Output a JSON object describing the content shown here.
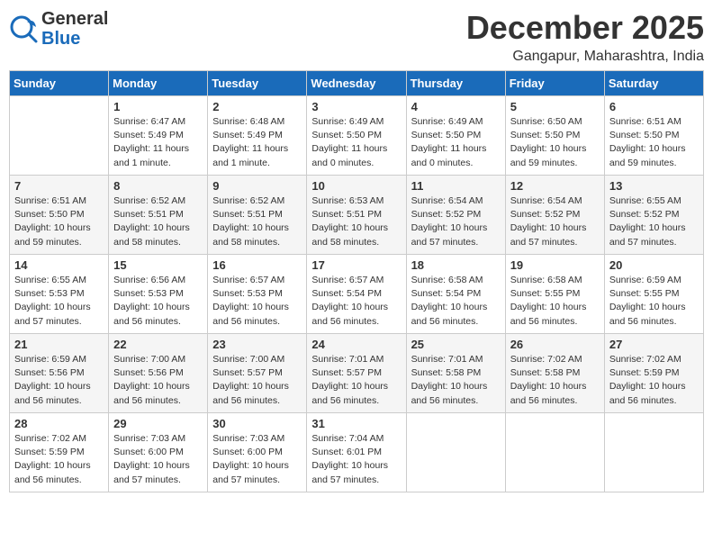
{
  "logo": {
    "general": "General",
    "blue": "Blue"
  },
  "title": {
    "month_year": "December 2025",
    "location": "Gangapur, Maharashtra, India"
  },
  "weekdays": [
    "Sunday",
    "Monday",
    "Tuesday",
    "Wednesday",
    "Thursday",
    "Friday",
    "Saturday"
  ],
  "weeks": [
    [
      {
        "day": "",
        "info": ""
      },
      {
        "day": "1",
        "info": "Sunrise: 6:47 AM\nSunset: 5:49 PM\nDaylight: 11 hours\nand 1 minute."
      },
      {
        "day": "2",
        "info": "Sunrise: 6:48 AM\nSunset: 5:49 PM\nDaylight: 11 hours\nand 1 minute."
      },
      {
        "day": "3",
        "info": "Sunrise: 6:49 AM\nSunset: 5:50 PM\nDaylight: 11 hours\nand 0 minutes."
      },
      {
        "day": "4",
        "info": "Sunrise: 6:49 AM\nSunset: 5:50 PM\nDaylight: 11 hours\nand 0 minutes."
      },
      {
        "day": "5",
        "info": "Sunrise: 6:50 AM\nSunset: 5:50 PM\nDaylight: 10 hours\nand 59 minutes."
      },
      {
        "day": "6",
        "info": "Sunrise: 6:51 AM\nSunset: 5:50 PM\nDaylight: 10 hours\nand 59 minutes."
      }
    ],
    [
      {
        "day": "7",
        "info": "Sunrise: 6:51 AM\nSunset: 5:50 PM\nDaylight: 10 hours\nand 59 minutes."
      },
      {
        "day": "8",
        "info": "Sunrise: 6:52 AM\nSunset: 5:51 PM\nDaylight: 10 hours\nand 58 minutes."
      },
      {
        "day": "9",
        "info": "Sunrise: 6:52 AM\nSunset: 5:51 PM\nDaylight: 10 hours\nand 58 minutes."
      },
      {
        "day": "10",
        "info": "Sunrise: 6:53 AM\nSunset: 5:51 PM\nDaylight: 10 hours\nand 58 minutes."
      },
      {
        "day": "11",
        "info": "Sunrise: 6:54 AM\nSunset: 5:52 PM\nDaylight: 10 hours\nand 57 minutes."
      },
      {
        "day": "12",
        "info": "Sunrise: 6:54 AM\nSunset: 5:52 PM\nDaylight: 10 hours\nand 57 minutes."
      },
      {
        "day": "13",
        "info": "Sunrise: 6:55 AM\nSunset: 5:52 PM\nDaylight: 10 hours\nand 57 minutes."
      }
    ],
    [
      {
        "day": "14",
        "info": "Sunrise: 6:55 AM\nSunset: 5:53 PM\nDaylight: 10 hours\nand 57 minutes."
      },
      {
        "day": "15",
        "info": "Sunrise: 6:56 AM\nSunset: 5:53 PM\nDaylight: 10 hours\nand 56 minutes."
      },
      {
        "day": "16",
        "info": "Sunrise: 6:57 AM\nSunset: 5:53 PM\nDaylight: 10 hours\nand 56 minutes."
      },
      {
        "day": "17",
        "info": "Sunrise: 6:57 AM\nSunset: 5:54 PM\nDaylight: 10 hours\nand 56 minutes."
      },
      {
        "day": "18",
        "info": "Sunrise: 6:58 AM\nSunset: 5:54 PM\nDaylight: 10 hours\nand 56 minutes."
      },
      {
        "day": "19",
        "info": "Sunrise: 6:58 AM\nSunset: 5:55 PM\nDaylight: 10 hours\nand 56 minutes."
      },
      {
        "day": "20",
        "info": "Sunrise: 6:59 AM\nSunset: 5:55 PM\nDaylight: 10 hours\nand 56 minutes."
      }
    ],
    [
      {
        "day": "21",
        "info": "Sunrise: 6:59 AM\nSunset: 5:56 PM\nDaylight: 10 hours\nand 56 minutes."
      },
      {
        "day": "22",
        "info": "Sunrise: 7:00 AM\nSunset: 5:56 PM\nDaylight: 10 hours\nand 56 minutes."
      },
      {
        "day": "23",
        "info": "Sunrise: 7:00 AM\nSunset: 5:57 PM\nDaylight: 10 hours\nand 56 minutes."
      },
      {
        "day": "24",
        "info": "Sunrise: 7:01 AM\nSunset: 5:57 PM\nDaylight: 10 hours\nand 56 minutes."
      },
      {
        "day": "25",
        "info": "Sunrise: 7:01 AM\nSunset: 5:58 PM\nDaylight: 10 hours\nand 56 minutes."
      },
      {
        "day": "26",
        "info": "Sunrise: 7:02 AM\nSunset: 5:58 PM\nDaylight: 10 hours\nand 56 minutes."
      },
      {
        "day": "27",
        "info": "Sunrise: 7:02 AM\nSunset: 5:59 PM\nDaylight: 10 hours\nand 56 minutes."
      }
    ],
    [
      {
        "day": "28",
        "info": "Sunrise: 7:02 AM\nSunset: 5:59 PM\nDaylight: 10 hours\nand 56 minutes."
      },
      {
        "day": "29",
        "info": "Sunrise: 7:03 AM\nSunset: 6:00 PM\nDaylight: 10 hours\nand 57 minutes."
      },
      {
        "day": "30",
        "info": "Sunrise: 7:03 AM\nSunset: 6:00 PM\nDaylight: 10 hours\nand 57 minutes."
      },
      {
        "day": "31",
        "info": "Sunrise: 7:04 AM\nSunset: 6:01 PM\nDaylight: 10 hours\nand 57 minutes."
      },
      {
        "day": "",
        "info": ""
      },
      {
        "day": "",
        "info": ""
      },
      {
        "day": "",
        "info": ""
      }
    ]
  ]
}
